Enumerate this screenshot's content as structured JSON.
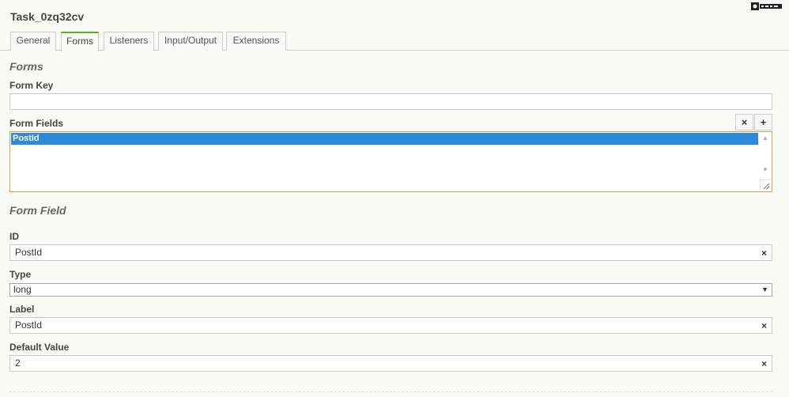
{
  "element_name": "Task_0zq32cv",
  "logo": "bpmn-io-logo",
  "tabs": [
    {
      "label": "General",
      "active": false
    },
    {
      "label": "Forms",
      "active": true
    },
    {
      "label": "Listeners",
      "active": false
    },
    {
      "label": "Input/Output",
      "active": false
    },
    {
      "label": "Extensions",
      "active": false
    }
  ],
  "forms_group": {
    "title": "Forms",
    "form_key": {
      "label": "Form Key",
      "value": ""
    },
    "form_fields": {
      "label": "Form Fields",
      "remove_label": "×",
      "add_label": "+",
      "items": [
        "PostId"
      ],
      "selected": "PostId"
    }
  },
  "form_field_group": {
    "title": "Form Field",
    "id": {
      "label": "ID",
      "value": "PostId"
    },
    "type": {
      "label": "Type",
      "value": "long"
    },
    "field_label": {
      "label": "Label",
      "value": "PostId"
    },
    "default_value": {
      "label": "Default Value",
      "value": "2"
    },
    "clear_label": "×"
  },
  "colors": {
    "active_tab_accent": "#52b415",
    "selected_option_bg": "#2b8bd8",
    "focus_border": "#d6a44c"
  }
}
